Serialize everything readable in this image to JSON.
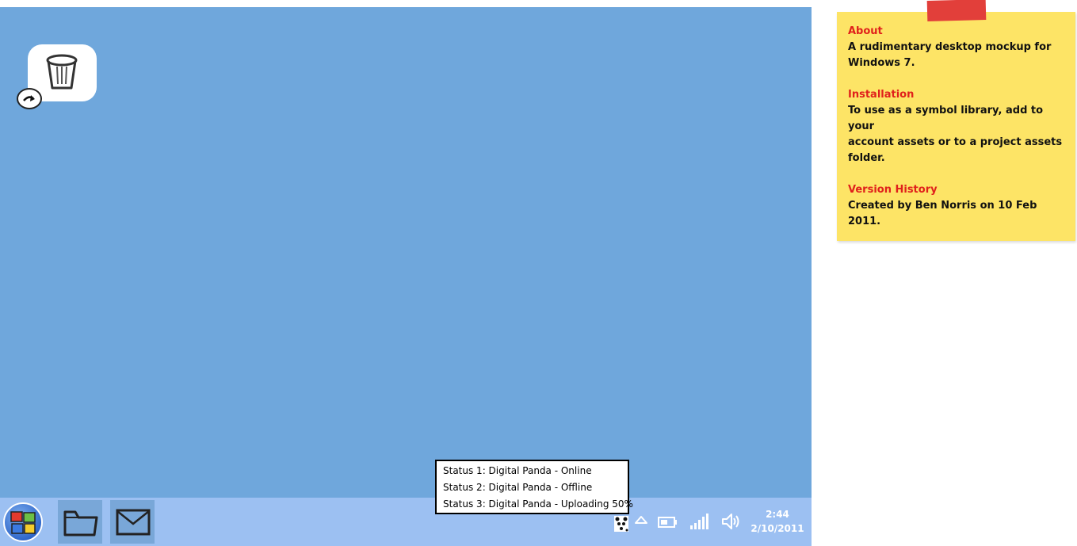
{
  "desktop": {
    "background_color": "#6fa7dc",
    "icons": [
      {
        "name": "recycle-bin",
        "icon": "trash-icon"
      },
      {
        "name": "shortcut-overlay",
        "icon": "arrow-right-icon"
      }
    ]
  },
  "taskbar": {
    "background_color": "#9cc0f2",
    "start_icon": "windows-logo-icon",
    "pinned": [
      {
        "icon": "folder-icon"
      },
      {
        "icon": "mail-icon"
      }
    ],
    "tray": {
      "icons": [
        "status-panda-icon",
        "show-hidden-icons-arrow-icon",
        "battery-icon",
        "signal-bars-icon",
        "volume-icon"
      ],
      "time": "2:44",
      "date": "2/10/2011"
    }
  },
  "tooltip": {
    "lines": [
      "Status 1: Digital Panda - Online",
      "Status 2: Digital Panda - Offline",
      "Status 3: Digital Panda - Uploading 50%"
    ]
  },
  "note": {
    "background_color": "#fde466",
    "tape_color": "#e23f3a",
    "heading_color": "#e0201b",
    "sections": [
      {
        "heading": "About",
        "lines": [
          "A rudimentary desktop mockup for",
          "Windows 7."
        ]
      },
      {
        "heading": "Installation",
        "lines": [
          "To use as a symbol library, add to your",
          "account assets or to a project assets",
          "folder."
        ]
      },
      {
        "heading": "Version History",
        "lines": [
          "Created by Ben Norris on 10 Feb 2011."
        ]
      }
    ]
  }
}
